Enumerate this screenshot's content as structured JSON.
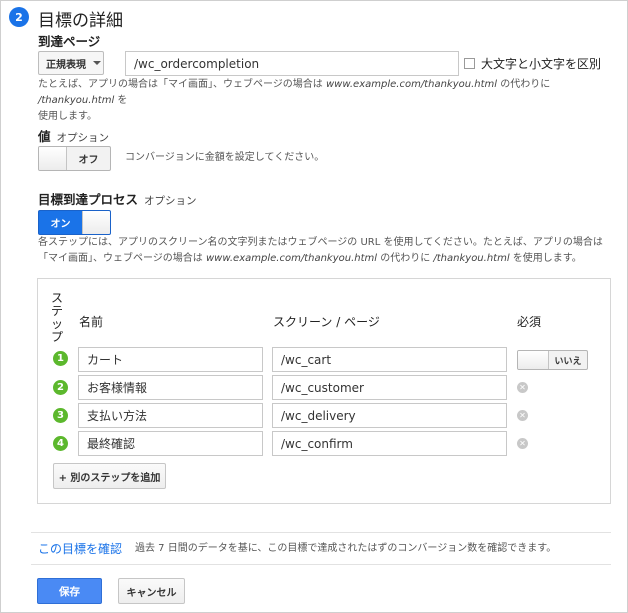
{
  "section": {
    "number": "2",
    "title": "目標の詳細"
  },
  "destination": {
    "label": "到達ページ",
    "match_type": "正規表現",
    "url_value": "/wc_ordercompletion",
    "case_sensitive_label": "大文字と小文字を区別",
    "help_part1": "たとえば、アプリの場合は「マイ画面」、ウェブページの場合は ",
    "help_example": "www.example.com/thankyou.html",
    "help_part2": " の代わりに ",
    "help_example2": "/thankyou.html",
    "help_part3": " を",
    "help_line2": "使用します。"
  },
  "value": {
    "label": "値",
    "optional": "オプション",
    "toggle_text": "オフ",
    "help": "コンバージョンに金額を設定してください。"
  },
  "funnel": {
    "label": "目標到達プロセス",
    "optional": "オプション",
    "toggle_text": "オン",
    "help_line1": "各ステップには、アプリのスクリーン名の文字列またはウェブページの URL を使用してください。たとえば、アプリの場合は",
    "help_line2_part1": "「マイ画面」、ウェブページの場合は ",
    "help_example": "www.example.com/thankyou.html",
    "help_line2_part2": " の代わりに ",
    "help_example2": "/thankyou.html",
    "help_line2_part3": " を使用します。",
    "col_step": "ステップ",
    "col_name": "名前",
    "col_screen": "スクリーン / ページ",
    "col_required": "必須",
    "required_toggle_text": "いいえ",
    "add_step_label": "+ 別のステップを追加",
    "steps": [
      {
        "num": "1",
        "name": "カート",
        "page": "/wc_cart"
      },
      {
        "num": "2",
        "name": "お客様情報",
        "page": "/wc_customer"
      },
      {
        "num": "3",
        "name": "支払い方法",
        "page": "/wc_delivery"
      },
      {
        "num": "4",
        "name": "最終確認",
        "page": "/wc_confirm"
      }
    ]
  },
  "verify": {
    "link": "この目標を確認",
    "desc": "過去 7 日間のデータを基に、この目標で達成されたはずのコンバージョン数を確認できます。"
  },
  "actions": {
    "save": "保存",
    "cancel": "キャンセル"
  },
  "colors": {
    "primary_blue": "#1a73e8",
    "step_green": "#5cb82d",
    "save_blue": "#4a8af4"
  }
}
